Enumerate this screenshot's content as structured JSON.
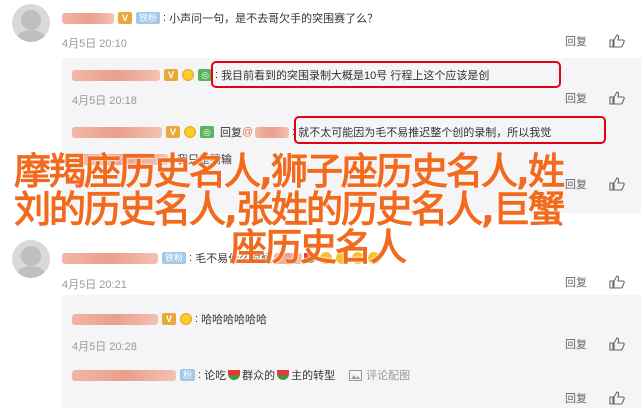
{
  "overlay": {
    "line1": "摩羯座历史名人,狮子座历史名人,姓",
    "line2": "刘的历史名人,张姓的历史名人,巨蟹",
    "line3": "座历史名人"
  },
  "top_comment": {
    "fans_badge": "铁粉",
    "text": "小声问一句，是不去哥欠手的突围赛了么？",
    "time": "4月5日 20:10",
    "reply": "回复"
  },
  "replies": [
    {
      "text": "我目前看到的突围录制大概是10号 行程上这个应该是创",
      "time": "4月5日 20:18",
      "reply": "回复"
    },
    {
      "reply_prefix": "回复",
      "mention": "@",
      "text": "就不太可能因为毛不易推迟整个创的录制，所以我觉",
      "time": "",
      "reply": "回复"
    },
    {
      "text": "我只是猜输",
      "time": "",
      "reply": "回复"
    }
  ],
  "comment2": {
    "fans_badge": "铁粉",
    "text": "毛不易什么时候",
    "time": "4月5日 20:21",
    "reply": "回复"
  },
  "comment3": {
    "text": "哈哈哈哈哈哈",
    "time": "4月5日 20:28",
    "reply": "回复"
  },
  "comment4": {
    "text_a": "论吃",
    "text_b": "群众的",
    "text_c": "主的转型",
    "report": "评论配图",
    "reply": "回复"
  }
}
